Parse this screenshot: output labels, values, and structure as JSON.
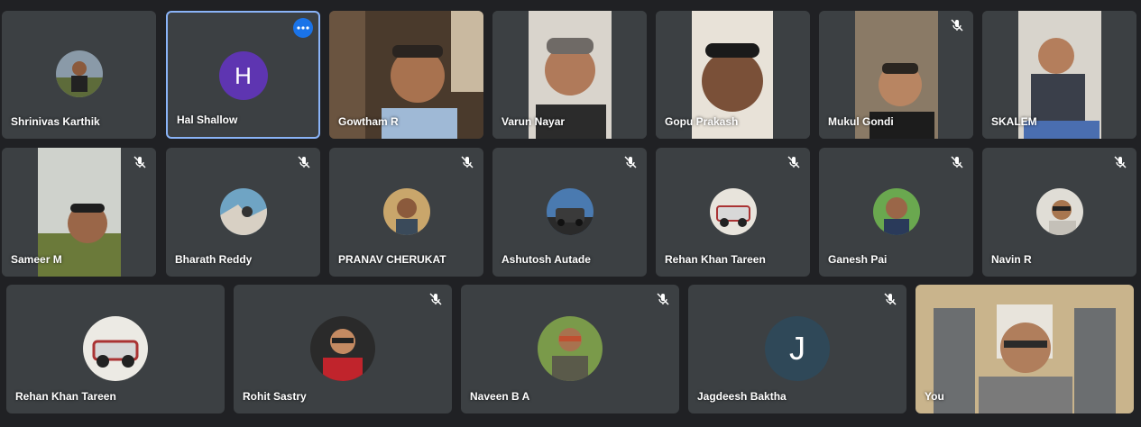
{
  "colors": {
    "page_bg": "#202124",
    "tile_bg": "#3c4043",
    "active_border": "#8ab4f8",
    "more_button": "#1a73e8"
  },
  "participants": [
    {
      "name": "Shrinivas Karthik",
      "type": "photo-avatar",
      "muted": false
    },
    {
      "name": "Hal Shallow",
      "type": "letter-avatar",
      "initial": "H",
      "avatar_color": "#5e35b1",
      "muted": false,
      "active": true,
      "has_more_menu": true
    },
    {
      "name": "Gowtham R",
      "type": "video",
      "muted": false
    },
    {
      "name": "Varun Nayar",
      "type": "video",
      "muted": false
    },
    {
      "name": "Gopu Prakash",
      "type": "video",
      "muted": false
    },
    {
      "name": "Mukul Gondi",
      "type": "video",
      "muted": true
    },
    {
      "name": "SKALEM",
      "type": "video",
      "muted": false
    },
    {
      "name": "Sameer M",
      "type": "video",
      "muted": true
    },
    {
      "name": "Bharath Reddy",
      "type": "photo-avatar",
      "muted": true
    },
    {
      "name": "PRANAV CHERUKAT",
      "type": "photo-avatar",
      "muted": true
    },
    {
      "name": "Ashutosh Autade",
      "type": "photo-avatar",
      "muted": true
    },
    {
      "name": "Rehan Khan Tareen",
      "type": "photo-avatar",
      "muted": true
    },
    {
      "name": "Ganesh Pai",
      "type": "photo-avatar",
      "muted": true
    },
    {
      "name": "Navin R",
      "type": "photo-avatar",
      "muted": true
    },
    {
      "name": "Rehan Khan Tareen",
      "type": "photo-avatar",
      "muted": false
    },
    {
      "name": "Rohit Sastry",
      "type": "photo-avatar",
      "muted": true
    },
    {
      "name": "Naveen B A",
      "type": "photo-avatar",
      "muted": true
    },
    {
      "name": "Jagdeesh Baktha",
      "type": "letter-avatar",
      "initial": "J",
      "avatar_color": "#2f4858",
      "muted": true
    },
    {
      "name": "You",
      "type": "video",
      "muted": false,
      "is_self": true
    }
  ]
}
